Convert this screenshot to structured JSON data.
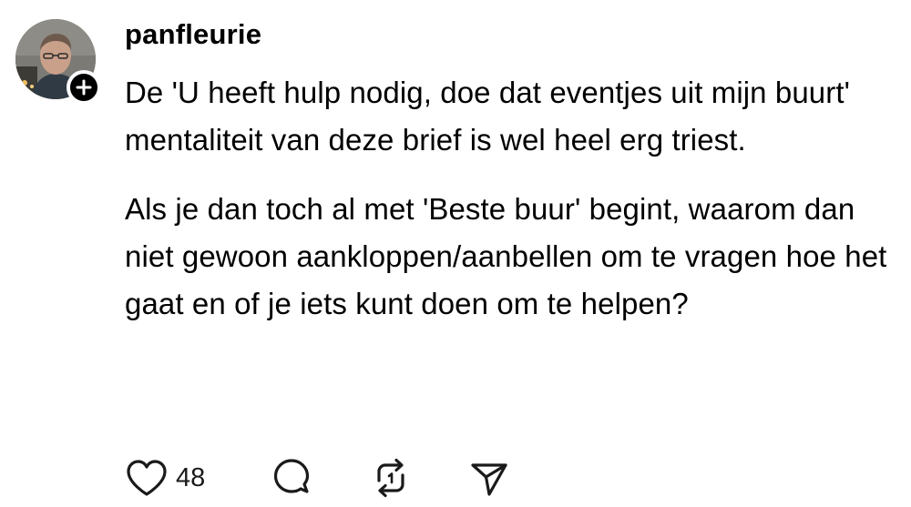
{
  "post": {
    "username": "panfleurie",
    "paragraphs": [
      "De 'U heeft hulp nodig, doe dat eventjes uit mijn buurt' mentaliteit van deze brief is wel heel erg triest.",
      "Als je dan toch al met 'Beste buur' begint, waarom dan niet gewoon aankloppen/aanbellen om te vragen hoe het gaat en of je iets kunt doen om te helpen?"
    ],
    "avatar_icon": "profile-photo",
    "follow_icon": "plus-icon"
  },
  "actions": {
    "like_count": "48",
    "like_icon": "heart-icon",
    "comment_icon": "comment-bubble-icon",
    "repost_icon": "repost-icon",
    "share_icon": "send-icon"
  },
  "colors": {
    "text": "#000000",
    "icon": "#1a1a1a",
    "background": "#ffffff"
  }
}
